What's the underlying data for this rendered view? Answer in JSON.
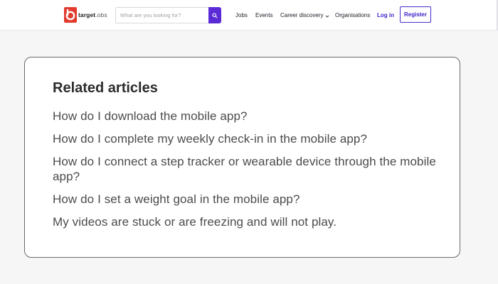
{
  "header": {
    "logo": {
      "name": "target",
      "suffix": ".obs",
      "icon": "target-logo-icon",
      "brand_color": "#e23b2e"
    },
    "search": {
      "placeholder": "What are you looking for?",
      "value": "",
      "button_icon": "search-icon",
      "button_color": "#5b2bd6"
    },
    "nav": {
      "jobs": "Jobs",
      "events": "Events",
      "career_discovery": "Career discovery",
      "career_discovery_icon": "chevron-down-icon",
      "organisations": "Organisations",
      "login": "Log in",
      "register": "Register"
    },
    "accent_color": "#3b21c9"
  },
  "related": {
    "title": "Related articles",
    "articles": [
      {
        "label": "How do I download the mobile app?"
      },
      {
        "label": "How do I complete my weekly check-in in the mobile app?"
      },
      {
        "label": "How do I connect a step tracker or wearable device through the mobile app?"
      },
      {
        "label": "How do I set a weight goal in the mobile app?"
      },
      {
        "label": "My videos are stuck or are freezing and will not play."
      }
    ]
  }
}
